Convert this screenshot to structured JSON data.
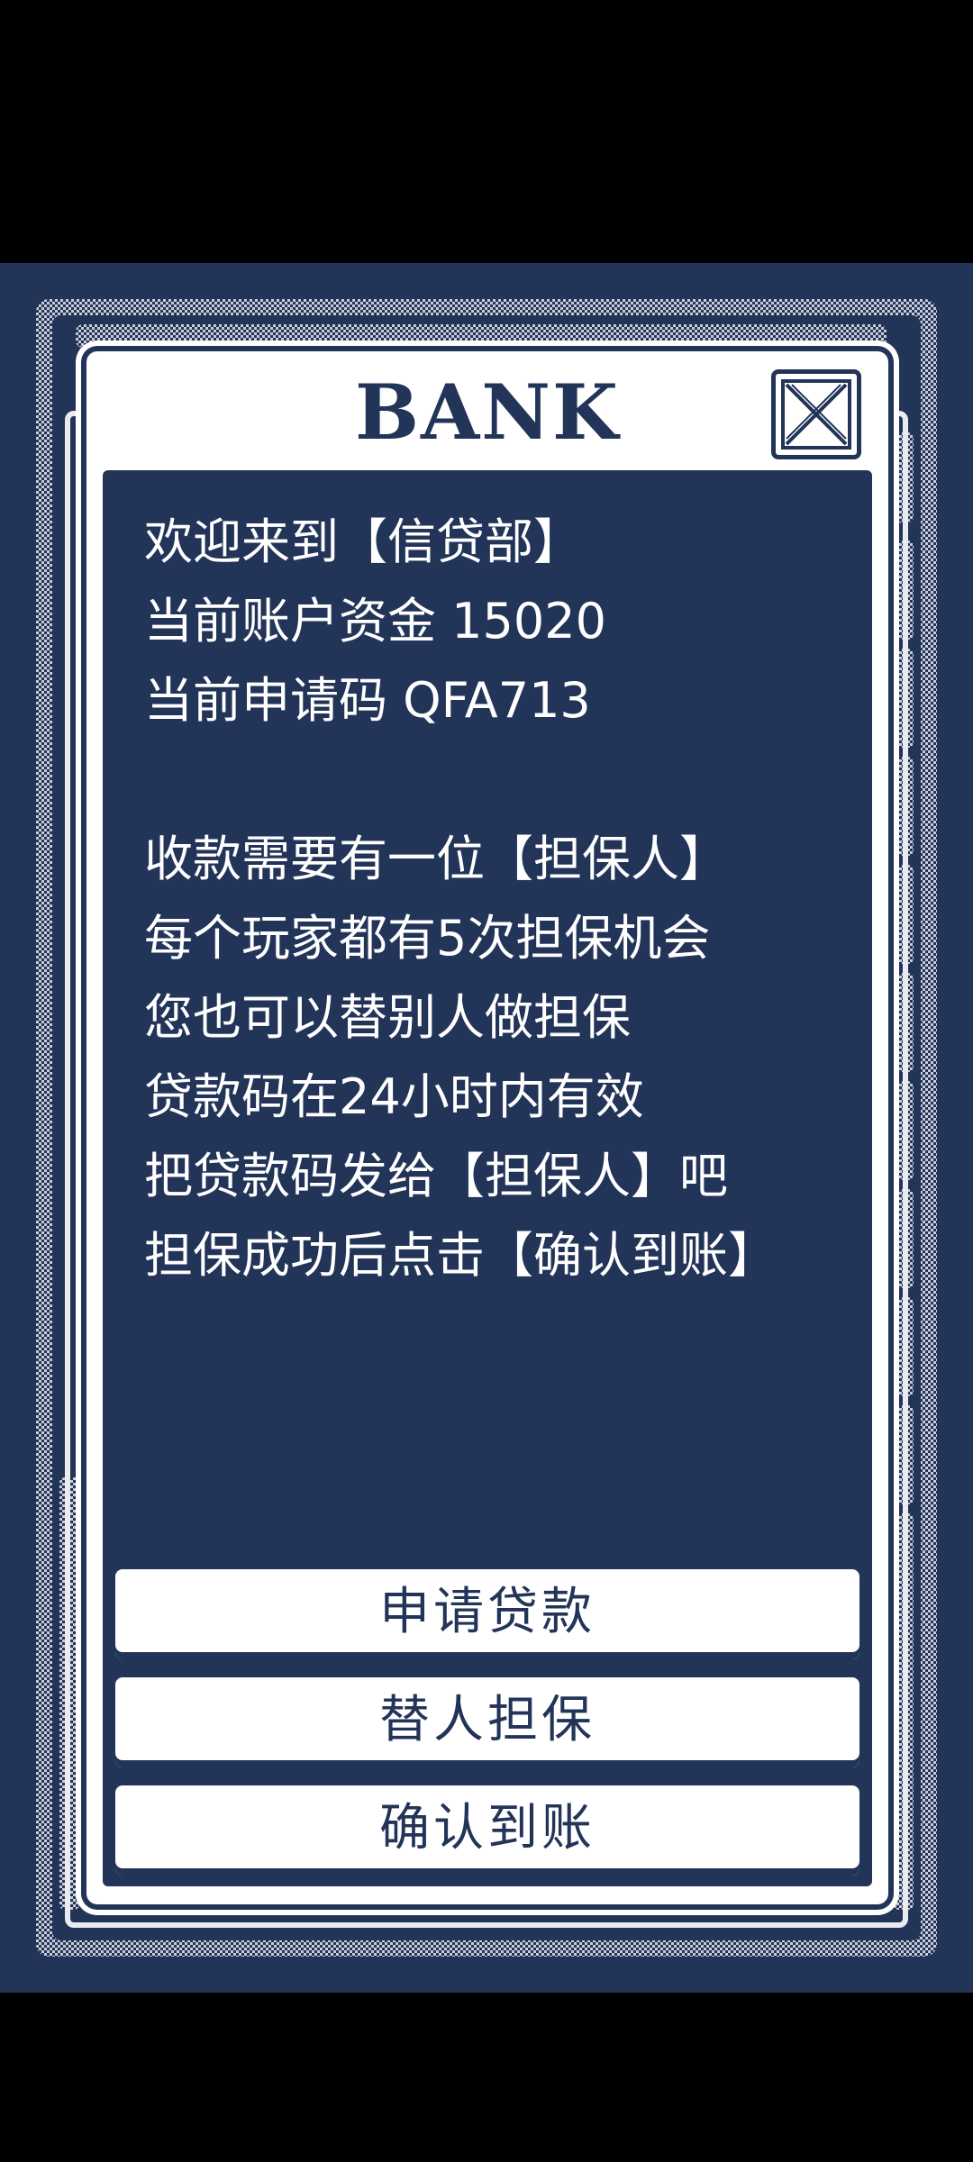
{
  "dialog": {
    "title": "BANK",
    "close_icon": "close-x-icon"
  },
  "info": {
    "lines_top": [
      "欢迎来到【信贷部】",
      "当前账户资金 15020",
      "当前申请码 QFA713"
    ],
    "lines_bottom": [
      "收款需要有一位【担保人】",
      "每个玩家都有5次担保机会",
      "您也可以替别人做担保",
      "贷款码在24小时内有效",
      "把贷款码发给【担保人】吧",
      "担保成功后点击【确认到账】"
    ]
  },
  "buttons": {
    "apply_loan": "申请贷款",
    "guarantee_for_others": "替人担保",
    "confirm_received": "确认到账"
  },
  "colors": {
    "background": "#000000",
    "game_bg": "#233459",
    "panel": "#ffffff",
    "text_light": "#ffffff",
    "text_dark": "#233459"
  }
}
